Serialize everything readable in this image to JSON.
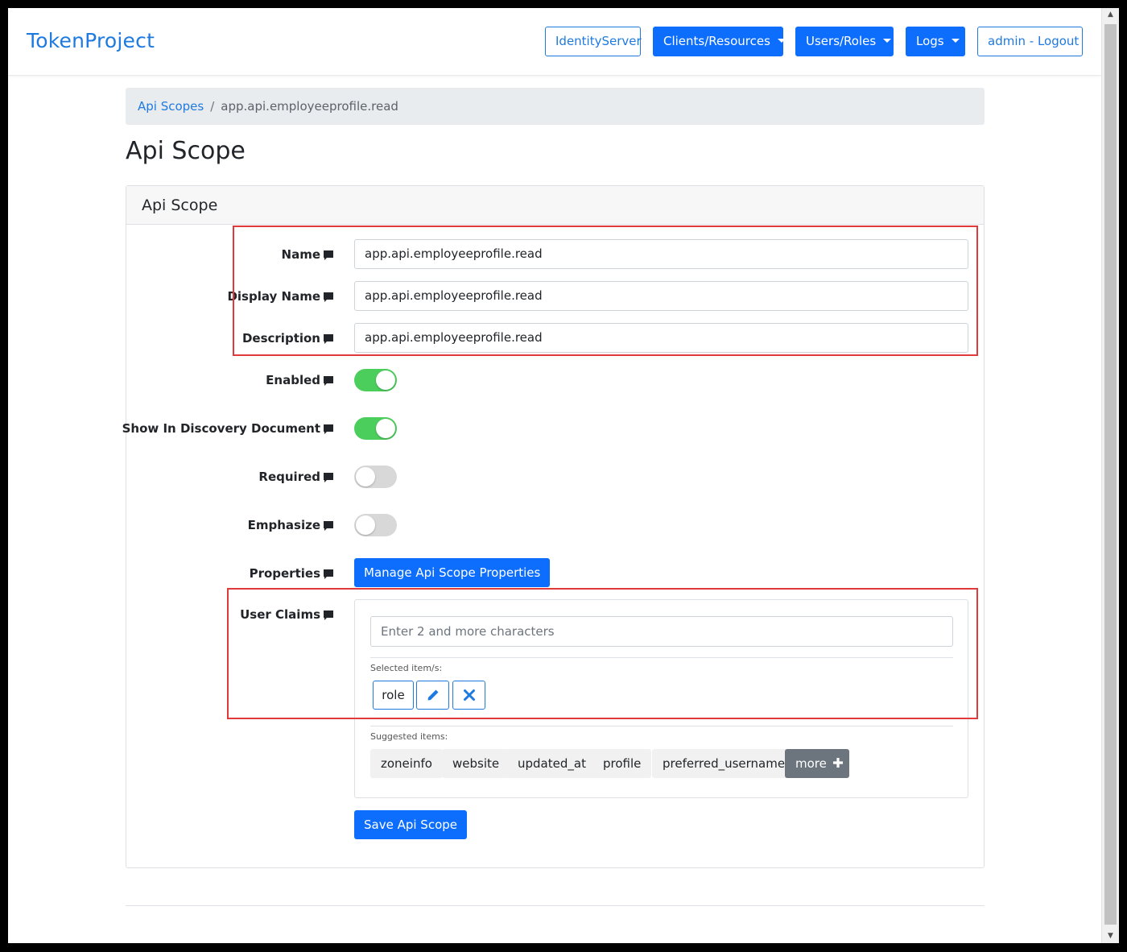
{
  "navbar": {
    "brand": "TokenProject",
    "items": [
      {
        "label": "IdentityServer",
        "style": "outline"
      },
      {
        "label": "Clients/Resources",
        "style": "dropdown"
      },
      {
        "label": "Users/Roles",
        "style": "dropdown"
      },
      {
        "label": "Logs",
        "style": "dropdown"
      },
      {
        "label": "admin - Logout",
        "style": "outline"
      }
    ]
  },
  "breadcrumb": {
    "link": "Api Scopes",
    "separator": "/",
    "current": "app.api.employeeprofile.read"
  },
  "page_title": "Api Scope",
  "card": {
    "header": "Api Scope",
    "fields": {
      "name": {
        "label": "Name",
        "value": "app.api.employeeprofile.read"
      },
      "display_name": {
        "label": "Display Name",
        "value": "app.api.employeeprofile.read"
      },
      "description": {
        "label": "Description",
        "value": "app.api.employeeprofile.read"
      },
      "enabled": {
        "label": "Enabled",
        "checked": true
      },
      "show_in_discovery": {
        "label": "Show In Discovery Document",
        "checked": true
      },
      "required": {
        "label": "Required",
        "checked": false
      },
      "emphasize": {
        "label": "Emphasize",
        "checked": false
      },
      "properties": {
        "label": "Properties",
        "button": "Manage Api Scope Properties"
      },
      "user_claims": {
        "label": "User Claims",
        "placeholder": "Enter 2 and more characters",
        "selected_label": "Selected item/s:",
        "selected": [
          "role"
        ],
        "suggested_label": "Suggested items:",
        "suggested": [
          "zoneinfo",
          "website",
          "updated_at",
          "profile",
          "preferred_username"
        ],
        "more_label": "more"
      }
    },
    "save_button": "Save Api Scope"
  },
  "colors": {
    "primary": "#0d6efd",
    "toggle_on": "#4cce5c",
    "highlight": "#e03a3a"
  }
}
